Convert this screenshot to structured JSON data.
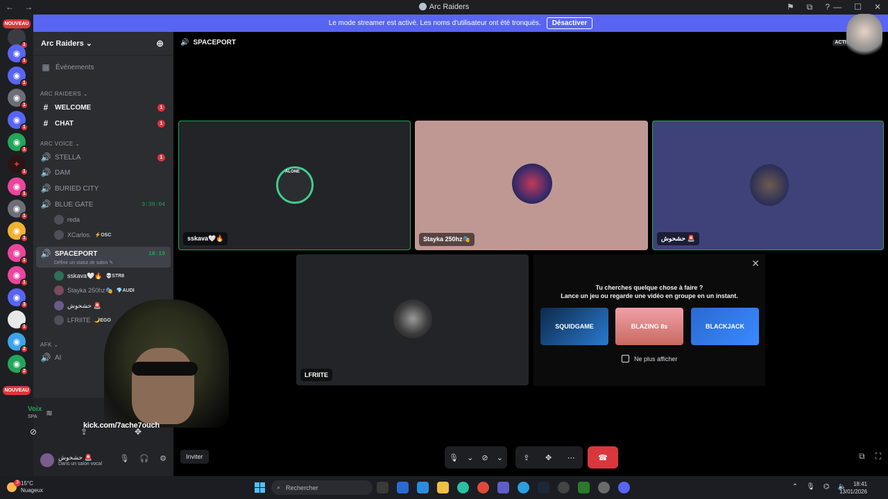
{
  "window": {
    "title": "Arc Raiders",
    "nav": "← →",
    "tools": [
      "⚑",
      "⧉",
      "?"
    ],
    "controls": [
      "—",
      "☐",
      "✕"
    ]
  },
  "banner": {
    "text": "Le mode streamer est activé. Les noms d'utilisateur ont été tronqués.",
    "button": "Désactiver"
  },
  "servers": {
    "nouveau_top": "NOUVEAU",
    "nouveau_bottom": "NOUVEAU",
    "badges": [
      "1",
      "1",
      "1",
      "1",
      "1",
      "1",
      "1",
      "1",
      "1",
      "1",
      "1",
      "1",
      "3",
      "1",
      "2",
      "2"
    ]
  },
  "guild": {
    "name": "Arc Raiders ⌄",
    "invite_icon": "person-add-icon"
  },
  "sidebar": {
    "events": "Événements",
    "cat_arc_raiders": "ARC RAIDERS ⌄",
    "welcome": "WELCOME",
    "chat": "CHAT",
    "welcome_badge": "1",
    "chat_badge": "1",
    "cat_arc_voice": "ARC VOICE ⌄",
    "stella": "STELLA",
    "stella_badge": "1",
    "dam": "DAM",
    "buried_city": "BURIED CITY",
    "blue_gate": "BLUE GATE",
    "blue_gate_timer": "3:39:04",
    "user_reda": "reda",
    "user_xcarlos": "XCarlos.",
    "user_xcarlos_tag": "⚡OSC",
    "spaceport": "SPACEPORT",
    "spaceport_timer": "18:19",
    "spaceport_status": "Définir un statut de salon ✎",
    "user_sskava": "sskava🤍🔥",
    "user_sskava_tag": "💀STR8",
    "user_stayka": "Stayka 250hz🎭",
    "user_stayka_tag": "💎AUDI",
    "user_hachrouch": "حشحوش 🚨",
    "user_lfriite": "LFRIITE",
    "user_lfriite_tag": "🌙EGO",
    "cat_afk": "AFK ⌄",
    "afk_channel": "AI"
  },
  "voice_panel": {
    "label": "Voix",
    "sub": "SPA"
  },
  "user_panel": {
    "name": "حشحوش 🚨",
    "status": "Dans un salon vocal"
  },
  "stage": {
    "channel": "SPACEPORT",
    "live_badge": "ACTIVÉ",
    "tiles": [
      {
        "label": "sskava🤍🔥",
        "avatar_text": "ALONE"
      },
      {
        "label": "Stayka 250hz🎭"
      },
      {
        "label": "حشحوش 🚨"
      },
      {
        "label": "LFRIITE"
      }
    ]
  },
  "promo": {
    "line1": "Tu cherches quelque chose à faire ?",
    "line2": "Lance un jeu ou regarde une vidéo en groupe en un instant.",
    "games": [
      "SQUIDGAME",
      "BLAZING 8s",
      "BLACKJACK"
    ],
    "checkbox": "Ne plus afficher"
  },
  "bottom": {
    "invite": "Inviter"
  },
  "overlay": {
    "kick": "kick.com/7ache7ouch"
  },
  "taskbar": {
    "weather_temp": "15°C",
    "weather_desc": "Nuageux",
    "weather_badge": "3",
    "search": "Rechercher",
    "time": "18:41",
    "date": "13/01/2026"
  }
}
